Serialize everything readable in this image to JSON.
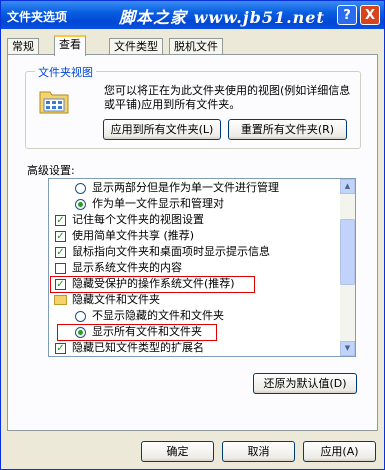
{
  "window": {
    "title": "文件夹选项",
    "watermark": "脚本之家 www.jb51.net",
    "help_label": "?",
    "close_label": "X"
  },
  "tabs": [
    {
      "label": "常规",
      "active": false
    },
    {
      "label": "查看",
      "active": true
    },
    {
      "label": "文件类型",
      "active": false
    },
    {
      "label": "脱机文件",
      "active": false
    }
  ],
  "folder_views": {
    "legend": "文件夹视图",
    "description": "您可以将正在为此文件夹使用的视图(例如详细信息或平铺)应用到所有文件夹。",
    "apply_all_label": "应用到所有文件夹(L)",
    "reset_all_label": "重置所有文件夹(R)"
  },
  "advanced": {
    "label": "高级设置:",
    "items": [
      {
        "type": "radio",
        "checked": false,
        "indent": 1,
        "label": "显示两部分但是作为单一文件进行管理"
      },
      {
        "type": "radio",
        "checked": true,
        "indent": 1,
        "label": "作为单一文件显示和管理对"
      },
      {
        "type": "checkbox",
        "checked": true,
        "indent": 0,
        "label": "记住每个文件夹的视图设置"
      },
      {
        "type": "checkbox",
        "checked": true,
        "indent": 0,
        "label": "使用简单文件共享 (推荐)"
      },
      {
        "type": "checkbox",
        "checked": true,
        "indent": 0,
        "label": "鼠标指向文件夹和桌面项时显示提示信息"
      },
      {
        "type": "checkbox",
        "checked": false,
        "indent": 0,
        "label": "显示系统文件夹的内容"
      },
      {
        "type": "checkbox",
        "checked": true,
        "indent": 0,
        "label": "隐藏受保护的操作系统文件(推荐)"
      },
      {
        "type": "folder",
        "checked": false,
        "indent": 0,
        "label": "隐藏文件和文件夹"
      },
      {
        "type": "radio",
        "checked": false,
        "indent": 1,
        "label": "不显示隐藏的文件和文件夹"
      },
      {
        "type": "radio",
        "checked": true,
        "indent": 1,
        "label": "显示所有文件和文件夹"
      },
      {
        "type": "checkbox",
        "checked": true,
        "indent": 0,
        "label": "隐藏已知文件类型的扩展名"
      }
    ]
  },
  "restore_defaults_label": "还原为默认值(D)",
  "footer": {
    "ok_label": "确定",
    "cancel_label": "取消",
    "apply_label": "应用(A)"
  },
  "colors": {
    "titlebar": "#0a5fe0",
    "highlight_box": "#e00000",
    "check_mark": "#21a121"
  }
}
